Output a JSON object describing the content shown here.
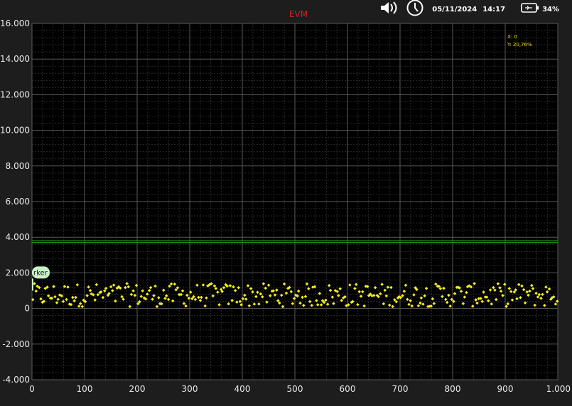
{
  "status_bar": {
    "date": "05/11/2024",
    "time": "14:17",
    "battery_percent": "34%",
    "icons": [
      "volume-icon",
      "clock-icon",
      "battery-icon"
    ]
  },
  "readout": {
    "x_text": "X: 0",
    "y_text": "Y: 20,76%"
  },
  "marker": {
    "label": "rker"
  },
  "colors": {
    "background": "#1d1d1d",
    "plot_background": "#000000",
    "grid_major": "#5a5a5a",
    "grid_minor": "#2a2a2a",
    "points": "#f3ee1c",
    "threshold_line": "#1e8a1e",
    "title": "#d32020",
    "readout": "#e4e000",
    "marker_fill": "#c8f0c8"
  },
  "chart_data": {
    "type": "scatter",
    "title": "EVM",
    "xlabel": "",
    "ylabel": "",
    "xlim": [
      0,
      1000
    ],
    "ylim": [
      -4000,
      16000
    ],
    "x_ticks": [
      "0",
      "100",
      "200",
      "300",
      "400",
      "500",
      "600",
      "700",
      "800",
      "900",
      "1.000"
    ],
    "x_tick_values": [
      0,
      100,
      200,
      300,
      400,
      500,
      600,
      700,
      800,
      900,
      1000
    ],
    "y_ticks": [
      "16.000",
      "14.000",
      "12.000",
      "10.000",
      "8.000",
      "6.000",
      "4.000",
      "2.000",
      "0",
      "-2.000",
      "-4.000"
    ],
    "y_tick_values": [
      16000,
      14000,
      12000,
      10000,
      8000,
      6000,
      4000,
      2000,
      0,
      -2000,
      -4000
    ],
    "grid": true,
    "threshold_lines": [
      3700,
      3800
    ],
    "marker_x": 0,
    "point_count": 330,
    "point_y_range": [
      100,
      1400
    ],
    "note_points": "approximately 330 scatter points spread between x = 0 and x = 1000, with y values fluctuating between about 100 and 1400"
  }
}
